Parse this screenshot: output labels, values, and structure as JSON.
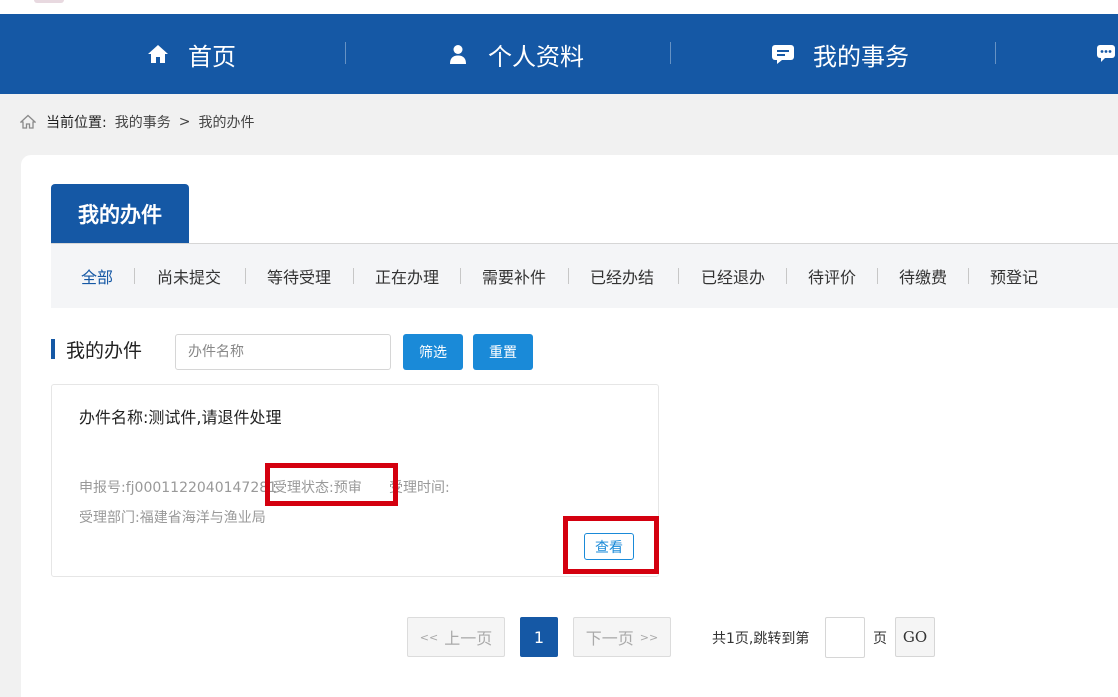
{
  "nav": {
    "home": "首页",
    "profile": "个人资料",
    "affairs": "我的事务"
  },
  "breadcrumb": {
    "label": "当前位置:",
    "level1": "我的事务",
    "separator": ">",
    "level2": "我的办件"
  },
  "page_tab": "我的办件",
  "filter_tabs": [
    "全部",
    "尚未提交",
    "等待受理",
    "正在办理",
    "需要补件",
    "已经办结",
    "已经退办",
    "待评价",
    "待缴费",
    "预登记"
  ],
  "section_title": "我的办件",
  "search": {
    "placeholder": "办件名称",
    "value": "",
    "filter_label": "筛选",
    "reset_label": "重置"
  },
  "card": {
    "name_label": "办件名称:",
    "name_value": "测试件,请退件处理",
    "apply_no": "申报号:fj0001122040147281",
    "status": "受理状态:预审",
    "accept_time": "受理时间:",
    "dept": "受理部门:福建省海洋与渔业局",
    "view_label": "查看"
  },
  "pagination": {
    "prev": "上一页",
    "prev_arrows": "<<",
    "current": "1",
    "next": "下一页",
    "next_arrows": ">>",
    "total_text": "共1页,跳转到第",
    "page_unit": "页",
    "go": "GO"
  },
  "colors": {
    "primary": "#1558a5",
    "button": "#1a8ad8",
    "highlight": "#d4000f"
  }
}
